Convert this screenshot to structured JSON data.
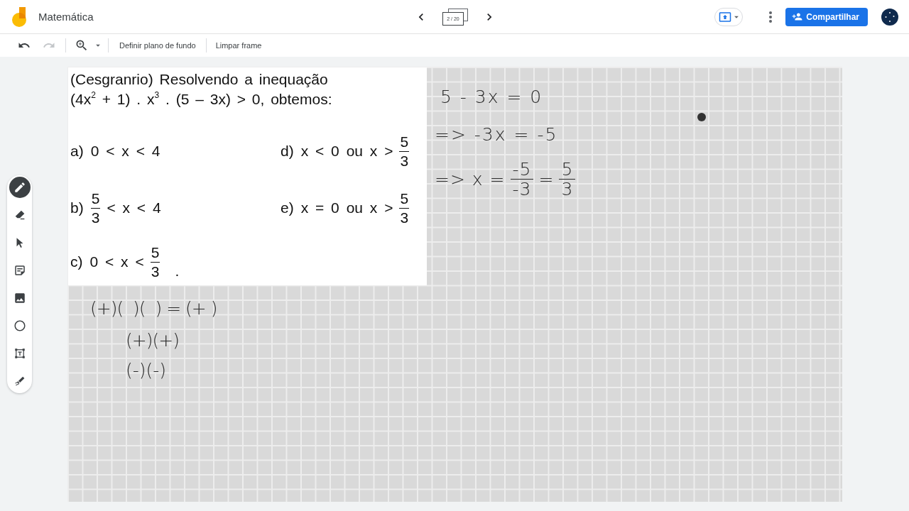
{
  "app_bar": {
    "title": "Matemática",
    "frame_counter": "2 / 20",
    "share_label": "Compartilhar"
  },
  "toolbar": {
    "undo": {
      "disabled": false
    },
    "redo": {
      "disabled": true
    },
    "actions": [
      "Definir plano de fundo",
      "Limpar frame"
    ]
  },
  "tools": [
    {
      "kind": "pen",
      "selected": true
    },
    {
      "kind": "eraser",
      "selected": false
    },
    {
      "kind": "select",
      "selected": false
    },
    {
      "kind": "sticky_note",
      "selected": false
    },
    {
      "kind": "image",
      "selected": false
    },
    {
      "kind": "circle",
      "selected": false
    },
    {
      "kind": "text_box",
      "selected": false
    },
    {
      "kind": "laser",
      "selected": false
    }
  ],
  "question": {
    "prompt": "(Cesgranrio) Resolvendo a inequação (4x$^{2}$ + 1) . x$^{3}$ . (5 – 3x) > 0, obtemos:",
    "options": [
      {
        "letter": "a)",
        "parts": [
          {
            "kind": "text",
            "text": "0 < x < 4"
          }
        ]
      },
      {
        "letter": "b)",
        "parts": [
          {
            "kind": "fraction",
            "numerator": "5",
            "denominator": "3"
          },
          {
            "kind": "text",
            "text": "< x < 4"
          }
        ]
      },
      {
        "letter": "c)",
        "parts": [
          {
            "kind": "text",
            "text": "0 < x <"
          },
          {
            "kind": "fraction",
            "numerator": "5",
            "denominator": "3"
          },
          {
            "kind": "punctuation",
            "text": "."
          }
        ]
      },
      {
        "letter": "d)",
        "parts": [
          {
            "kind": "text",
            "text": "x < 0 ou x >"
          },
          {
            "kind": "fraction",
            "numerator": "5",
            "denominator": "3"
          }
        ]
      },
      {
        "letter": "e)",
        "parts": [
          {
            "kind": "text",
            "text": "x = 0 ou x >"
          },
          {
            "kind": "fraction",
            "numerator": "5",
            "denominator": "3"
          }
        ]
      }
    ]
  },
  "handwriting": [
    {
      "parts": [
        {
          "kind": "text",
          "text": "5 - 3x = 0"
        }
      ]
    },
    {
      "parts": [
        {
          "kind": "text",
          "text": "=> -3x = -5"
        }
      ]
    },
    {
      "parts": [
        {
          "kind": "text",
          "text": "=> x ="
        },
        {
          "kind": "fraction",
          "numerator": "-5",
          "denominator": "-3"
        },
        {
          "kind": "text",
          "text": "="
        },
        {
          "kind": "fraction",
          "numerator": "5",
          "denominator": "3"
        }
      ]
    },
    {
      "parts": [
        {
          "kind": "text",
          "text": "(+)(  )(  ) = (+ )"
        }
      ]
    },
    {
      "parts": [
        {
          "kind": "text",
          "text": "(+)(+)"
        }
      ]
    },
    {
      "parts": [
        {
          "kind": "text",
          "text": "(-)(-)"
        }
      ]
    }
  ]
}
